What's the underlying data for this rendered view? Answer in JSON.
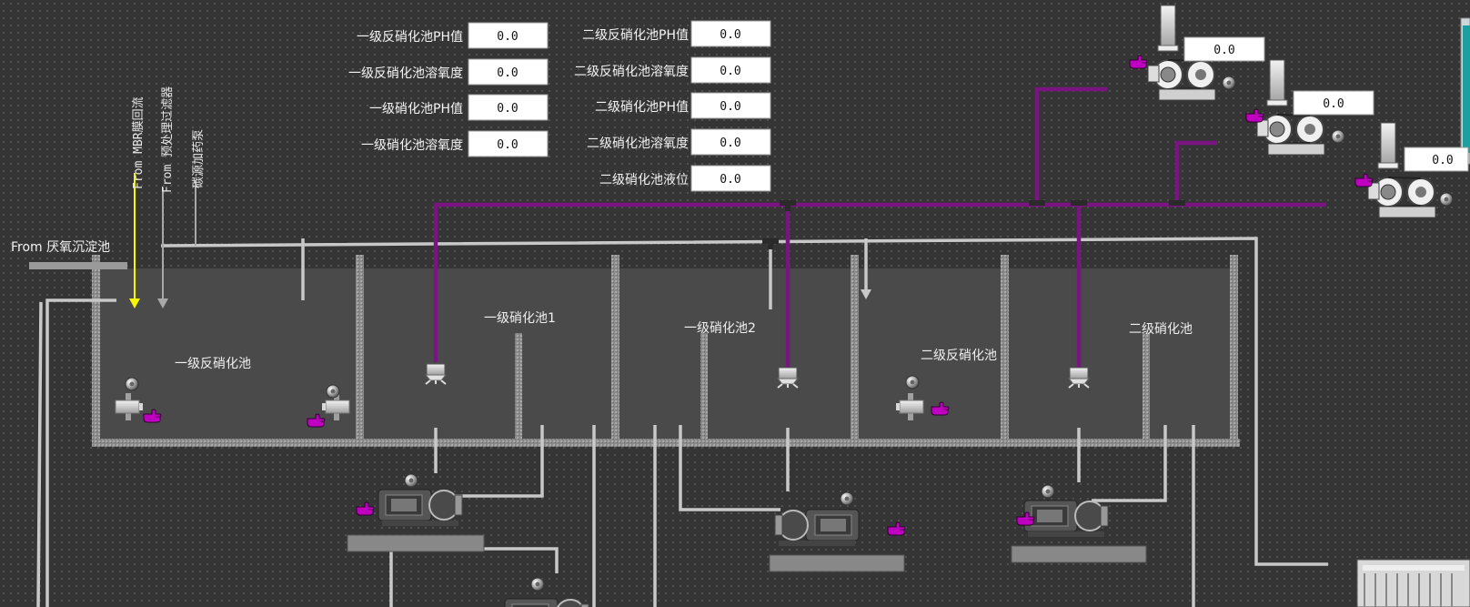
{
  "inflow_label": "From 厌氧沉淀池",
  "vertical_labels": [
    "From MBR膜回流",
    "From 预处理过滤器",
    "碳源加药泵"
  ],
  "tanks": [
    "一级反硝化池",
    "一级硝化池1",
    "一级硝化池2",
    "二级反硝化池",
    "二级硝化池"
  ],
  "readings": [
    {
      "label": "一级反硝化池PH值",
      "value": "0.0"
    },
    {
      "label": "一级反硝化池溶氧度",
      "value": "0.0"
    },
    {
      "label": "一级硝化池PH值",
      "value": "0.0"
    },
    {
      "label": "一级硝化池溶氧度",
      "value": "0.0"
    },
    {
      "label": "二级反硝化池PH值",
      "value": "0.0"
    },
    {
      "label": "二级反硝化池溶氧度",
      "value": "0.0"
    },
    {
      "label": "二级硝化池PH值",
      "value": "0.0"
    },
    {
      "label": "二级硝化池溶氧度",
      "value": "0.0"
    },
    {
      "label": "二级硝化池液位",
      "value": "0.0"
    }
  ],
  "blower_values": [
    "0.0",
    "0.0",
    "0.0"
  ],
  "colors": {
    "air_pipe": "#7a1480",
    "water_pipe": "#c8c8c8",
    "highlight_arrow": "#f6f600",
    "hand_icon": "#c000c0"
  },
  "icons": {
    "hand": "hand-pointer-icon",
    "status": "status-indicator-icon"
  }
}
